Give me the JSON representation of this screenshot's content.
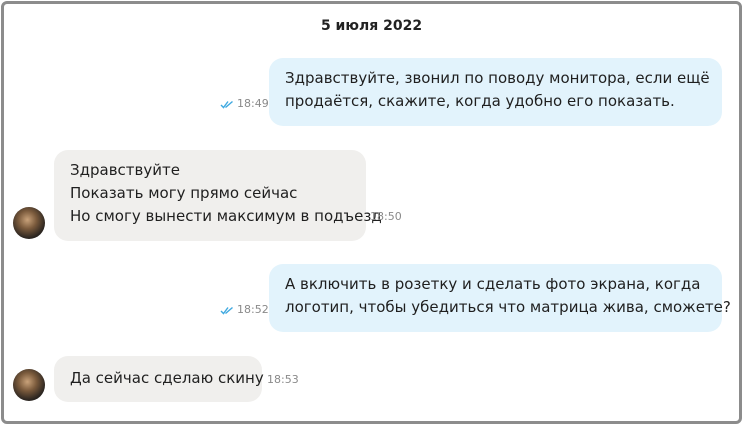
{
  "chat": {
    "date": "5 июля 2022",
    "messages": [
      {
        "direction": "out",
        "lines": [
          "Здравствуйте, звонил по поводу монитора, если ещё",
          "продаётся, скажите, когда удобно его показать."
        ],
        "time": "18:49",
        "status": "read"
      },
      {
        "direction": "in",
        "lines": [
          "Здравствуйте",
          "Показать могу прямо сейчас",
          "Но смогу вынести максимум в подъезд"
        ],
        "time": "18:50"
      },
      {
        "direction": "out",
        "lines": [
          "А включить в розетку и сделать фото экрана, когда",
          "логотип, чтобы убедиться что матрица жива, сможете?"
        ],
        "time": "18:52",
        "status": "read"
      },
      {
        "direction": "in",
        "lines": [
          "Да сейчас сделаю скину"
        ],
        "time": "18:53"
      }
    ]
  },
  "colors": {
    "outgoing_bubble": "#e2f3fc",
    "incoming_bubble": "#f0efed",
    "read_check": "#3fa9e0",
    "timestamp": "#8a8a8a"
  },
  "icons": {
    "read_status": "double-check-icon",
    "avatar": "user-avatar"
  }
}
